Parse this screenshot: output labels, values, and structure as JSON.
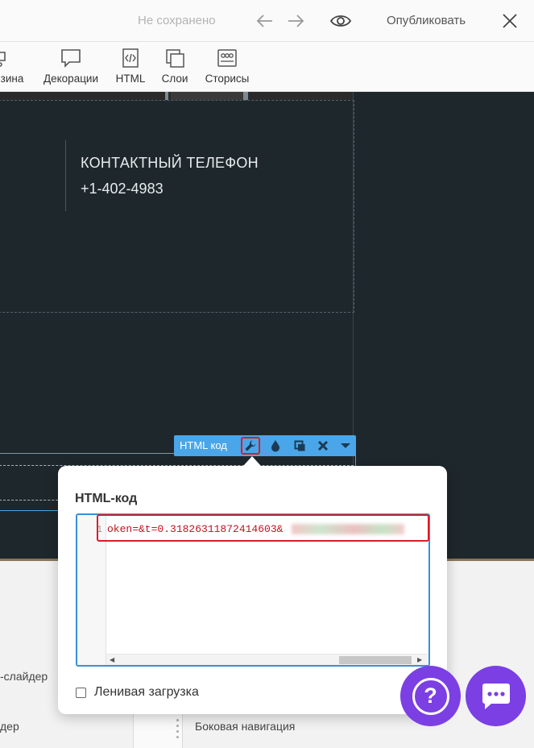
{
  "topbar": {
    "status": "Не сохранено",
    "publish_label": "Опубликовать",
    "icons": {
      "undo": "arrow-left-icon",
      "redo": "arrow-right-icon",
      "preview": "eye-icon",
      "close": "close-icon"
    }
  },
  "toolbar": {
    "items": [
      {
        "label": "зина",
        "icon": "cart-icon"
      },
      {
        "label": "Декорации",
        "icon": "speech-bubble-icon"
      },
      {
        "label": "HTML",
        "icon": "code-icon"
      },
      {
        "label": "Слои",
        "icon": "layers-icon"
      },
      {
        "label": "Сторисы",
        "icon": "stories-icon"
      }
    ]
  },
  "canvas": {
    "contact_label": "КОНТАКТНЫЙ ТЕЛЕФОН",
    "contact_phone": "+1-402-4983"
  },
  "block_toolbar": {
    "label": "HTML код",
    "buttons": [
      "wrench-icon",
      "drop-icon",
      "copy-icon",
      "delete-icon",
      "caret-down-icon"
    ]
  },
  "popup": {
    "title": "HTML-код",
    "line_number": "1",
    "code": "oken=&t=0.31826311872414603&",
    "lazy_label": "Ленивая загрузка"
  },
  "bottom_panel": {
    "item1": "-слайдер",
    "item2": "дер",
    "item3": "Боковая навигация"
  },
  "fabs": {
    "help_glyph": "?",
    "icons": [
      "help-icon",
      "chat-icon"
    ]
  },
  "colors": {
    "accent_blue": "#4aa6e8",
    "editor_border": "#3a8fd8",
    "highlight_red": "#e01b24",
    "fab_purple": "#7b3fe4",
    "canvas_bg": "#1e272c"
  }
}
